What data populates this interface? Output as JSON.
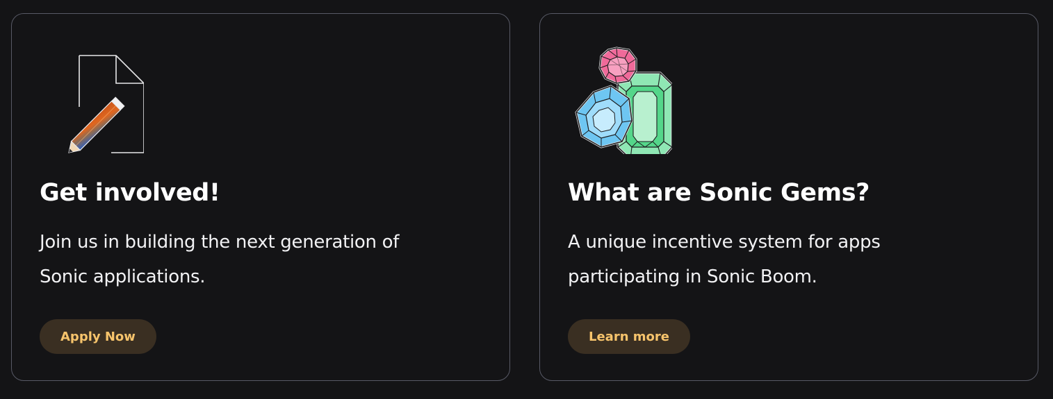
{
  "cards": [
    {
      "title": "Get involved!",
      "description": "Join us in building the next generation of Sonic applications.",
      "button_label": "Apply Now",
      "icon": "document-pencil-icon"
    },
    {
      "title": "What are Sonic Gems?",
      "description": "A unique incentive system for apps participating in Sonic Boom.",
      "button_label": "Learn more",
      "icon": "gems-icon"
    }
  ],
  "colors": {
    "background": "#141416",
    "card_border": "#585a66",
    "title": "#ffffff",
    "button_background": "#3a2f22",
    "button_text": "#f7c46c",
    "gem_pink": "#f06a9a",
    "gem_blue": "#6ec6f2",
    "gem_green": "#58d68d",
    "pencil_orange": "#e0661f",
    "pencil_blue": "#3b63b8"
  }
}
